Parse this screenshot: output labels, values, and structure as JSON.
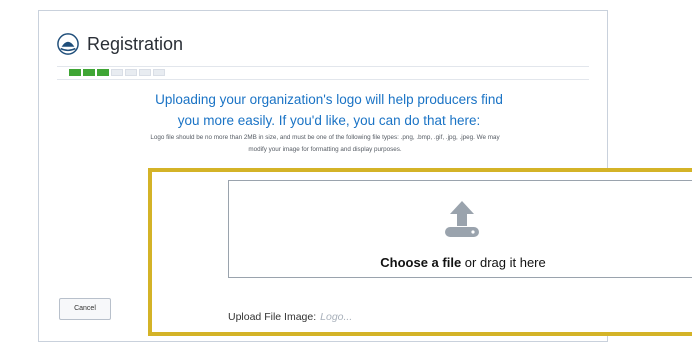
{
  "header": {
    "title": "Registration",
    "logo_icon": "org-dome-icon"
  },
  "progress": {
    "total_steps": 7,
    "completed_steps": 3,
    "done_color": "#3fa535"
  },
  "intro": {
    "line1": "Uploading your organization's logo will help producers find",
    "line2": "you more easily. If you'd like, you can do that here:"
  },
  "fine_print": "Logo file should be no more than 2MB in size, and must be one of the following file types: .png, .bmp, .gif, .jpg, .jpeg. We may modify your image for formatting and display purposes.",
  "footer": {
    "cancel_label": "Cancel"
  },
  "dropzone": {
    "icon": "upload-icon",
    "choose_label": "Choose a file",
    "drag_text": " or drag it here"
  },
  "upload_field": {
    "label": "Upload File Image:",
    "placeholder": "Logo..."
  },
  "colors": {
    "accent_blue": "#1a73c5",
    "highlight_gold": "#d4b327"
  }
}
